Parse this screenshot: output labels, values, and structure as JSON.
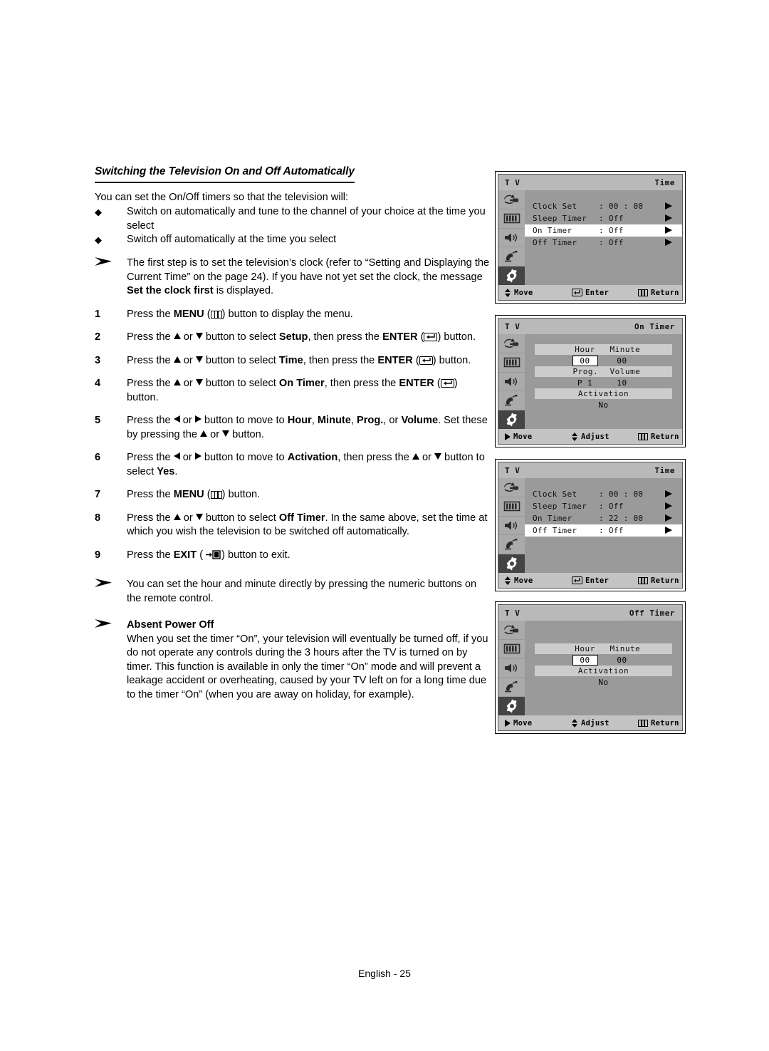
{
  "page": {
    "footer": "English - 25"
  },
  "article": {
    "title": "Switching the Television On and Off Automatically",
    "intro": "You can set the On/Off timers so that the television will:",
    "bullets": [
      "Switch on automatically and tune to the channel of your choice at the time you select",
      "Switch off automatically at the time you select"
    ],
    "note_first": {
      "p1": "The first step is to set the television’s clock (refer to “Setting and Displaying the Current Time” on the page 24). If you have not yet set the clock, the message ",
      "bold1": "Set the clock first",
      "p2": " is displayed."
    },
    "steps": [
      {
        "num": "1",
        "a": "Press the ",
        "b1": "MENU",
        "b": " (",
        "icon": "menu-icon",
        "c": ") button to display the menu."
      },
      {
        "num": "2",
        "a": "Press the ",
        "up": "▲",
        "or": " or ",
        "dn": "▼",
        "b": " button to select ",
        "b1": "Setup",
        "c": ", then press the ",
        "b2": "ENTER",
        "d": " (",
        "icon": "enter-icon",
        "e": ") button."
      },
      {
        "num": "3",
        "a": "Press the ",
        "b": " button to select ",
        "b1": "Time",
        "c": ", then press the ",
        "b2": "ENTER",
        "d": " (",
        "icon": "enter-icon",
        "e": ") button."
      },
      {
        "num": "4",
        "a": "Press the ",
        "b": " button to select ",
        "b1": "On Timer",
        "c": ", then press the ",
        "b2": "ENTER",
        "d": " (",
        "icon": "enter-icon",
        "e": ") button."
      },
      {
        "num": "5",
        "a": "Press the ",
        "b": " button to move to ",
        "b1": "Hour",
        "sep1": ", ",
        "b2": "Minute",
        "sep2": ", ",
        "b3": "Prog.",
        "sep3": ", or ",
        "b4": "Volume",
        "c": ". Set these by pressing the ",
        "d": " button."
      },
      {
        "num": "6",
        "a": "Press the ",
        "b": " button to move to ",
        "b1": "Activation",
        "c": ", then press the ",
        "d": " button to select ",
        "b2": "Yes",
        "e": "."
      },
      {
        "num": "7",
        "a": "Press the ",
        "b1": "MENU",
        "b": " (",
        "icon": "menu-icon",
        "c": ") button."
      },
      {
        "num": "8",
        "a": "Press the ",
        "b": " button to select ",
        "b1": "Off Timer",
        "c": ". In the same above, set the time at which you wish the television to be switched off automatically."
      },
      {
        "num": "9",
        "a": "Press the ",
        "b1": "EXIT",
        "b": " ( ",
        "icon": "exit-icon",
        "c": ") button to exit."
      }
    ],
    "note_numeric": "You can set the hour and minute directly by pressing the numeric buttons on the remote control.",
    "note_absent": {
      "heading": "Absent Power Off",
      "text": "When you set the timer “On”, your television will eventually be turned off, if you do not operate any controls during the 3 hours after the TV is turned on by timer. This function is available in only the timer “On” mode and will prevent a leakage accident or overheating, caused by your TV left on for a long time due to the timer “On”  (when you are away on holiday, for example)."
    }
  },
  "osd_common": {
    "brand": "T V",
    "sidebar_icons": [
      "input-icon",
      "picture-icon",
      "sound-icon",
      "satellite-icon",
      "setup-gear-icon"
    ],
    "selected_sidebar_index": 4
  },
  "osd1": {
    "title": "Time",
    "rows": [
      {
        "label": "Clock Set",
        "value": ": 00 : 00",
        "highlighted": false
      },
      {
        "label": "Sleep Timer",
        "value": ": Off",
        "highlighted": false
      },
      {
        "label": "On Timer",
        "value": ": Off",
        "highlighted": true
      },
      {
        "label": "Off Timer",
        "value": ": Off",
        "highlighted": false
      }
    ],
    "footer": {
      "move": "Move",
      "enter": "Enter",
      "return": "Return"
    }
  },
  "osd2": {
    "title": "On Timer",
    "groups": [
      {
        "headers": [
          "Hour",
          "Minute"
        ],
        "values": [
          "00",
          "00"
        ],
        "selected": 0
      },
      {
        "headers": [
          "Prog.",
          "Volume"
        ],
        "values": [
          "P 1",
          "10"
        ],
        "selected": -1
      },
      {
        "headers": [
          "Activation"
        ],
        "values": [
          "No"
        ],
        "selected": -1
      }
    ],
    "footer": {
      "move": "Move",
      "adjust": "Adjust",
      "return": "Return"
    }
  },
  "osd3": {
    "title": "Time",
    "rows": [
      {
        "label": "Clock Set",
        "value": ": 00 : 00",
        "highlighted": false
      },
      {
        "label": "Sleep Timer",
        "value": ": Off",
        "highlighted": false
      },
      {
        "label": "On Timer",
        "value": ": 22 : 00",
        "highlighted": false
      },
      {
        "label": "Off Timer",
        "value": ": Off",
        "highlighted": true
      }
    ],
    "footer": {
      "move": "Move",
      "enter": "Enter",
      "return": "Return"
    }
  },
  "osd4": {
    "title": "Off Timer",
    "groups": [
      {
        "headers": [
          "Hour",
          "Minute"
        ],
        "values": [
          "00",
          "00"
        ],
        "selected": 0
      },
      {
        "headers": [
          "Activation"
        ],
        "values": [
          "No"
        ],
        "selected": -1
      }
    ],
    "footer": {
      "move": "Move",
      "adjust": "Adjust",
      "return": "Return"
    }
  },
  "colors": {
    "osd_bg": "#9a9a9a",
    "osd_title_bar": "#b9b9b9",
    "osd_sidebar": "#aaaaaa",
    "osd_sidebar_selected": "#444444",
    "osd_header_bar": "#cccccc",
    "osd_footer": "#c3c3c3",
    "highlight": "#ffffff"
  }
}
